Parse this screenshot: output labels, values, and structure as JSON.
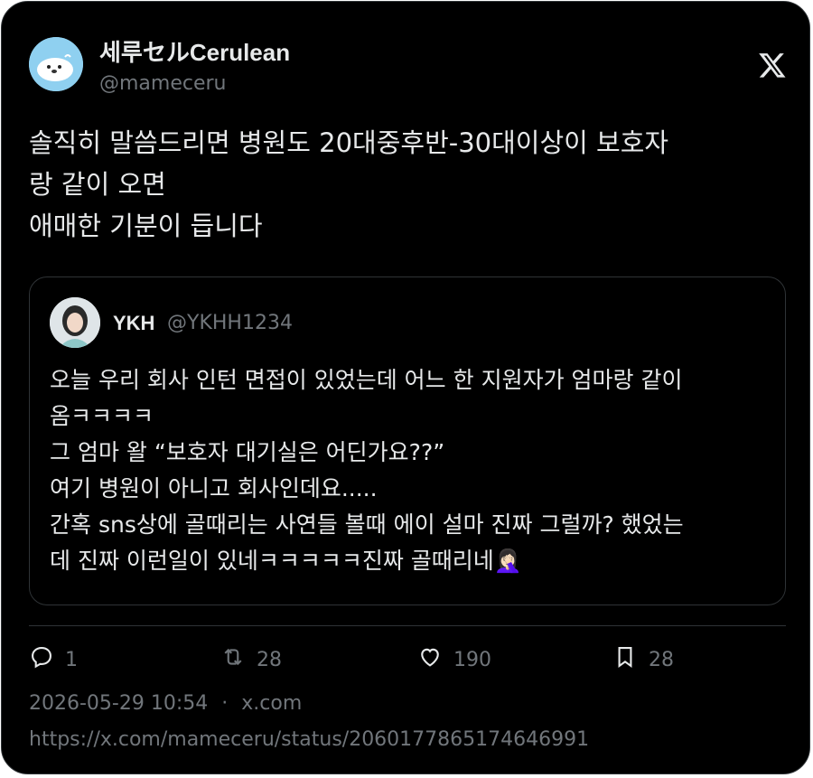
{
  "author": {
    "display_name": "세루セルCerulean",
    "handle": "@mameceru",
    "avatar_icon": "seal-avatar-icon"
  },
  "tweet": {
    "text": "솔직히 말씀드리면 병원도 20대중후반-30대이상이 보호자\n랑 같이 오면\n애매한 기분이 듭니다"
  },
  "quoted_tweet": {
    "display_name": "YKH",
    "handle": "@YKHH1234",
    "text": "오늘 우리 회사 인턴 면접이 있었는데 어느 한 지원자가 엄마랑 같이\n옴ㅋㅋㅋㅋ\n그 엄마 왈 “보호자 대기실은 어딘가요??”\n여기 병원이 아니고 회사인데요.....\n간혹 sns상에 골때리는 사연들 볼때 에이 설마 진짜 그럴까? 했었는\n데 진짜 이런일이 있네ㅋㅋㅋㅋㅋ진짜 골때리네🤦🏻‍♀️"
  },
  "actions": {
    "replies": "1",
    "retweets": "28",
    "likes": "190",
    "bookmarks": "28"
  },
  "meta": {
    "timestamp": "2026-05-29 10:54",
    "separator": "·",
    "source": "x.com",
    "url": "https://x.com/mameceru/status/2060177865174646991"
  },
  "colors": {
    "background": "#000000",
    "text": "#e7e9ea",
    "muted": "#71767b",
    "border": "#2f3336"
  }
}
